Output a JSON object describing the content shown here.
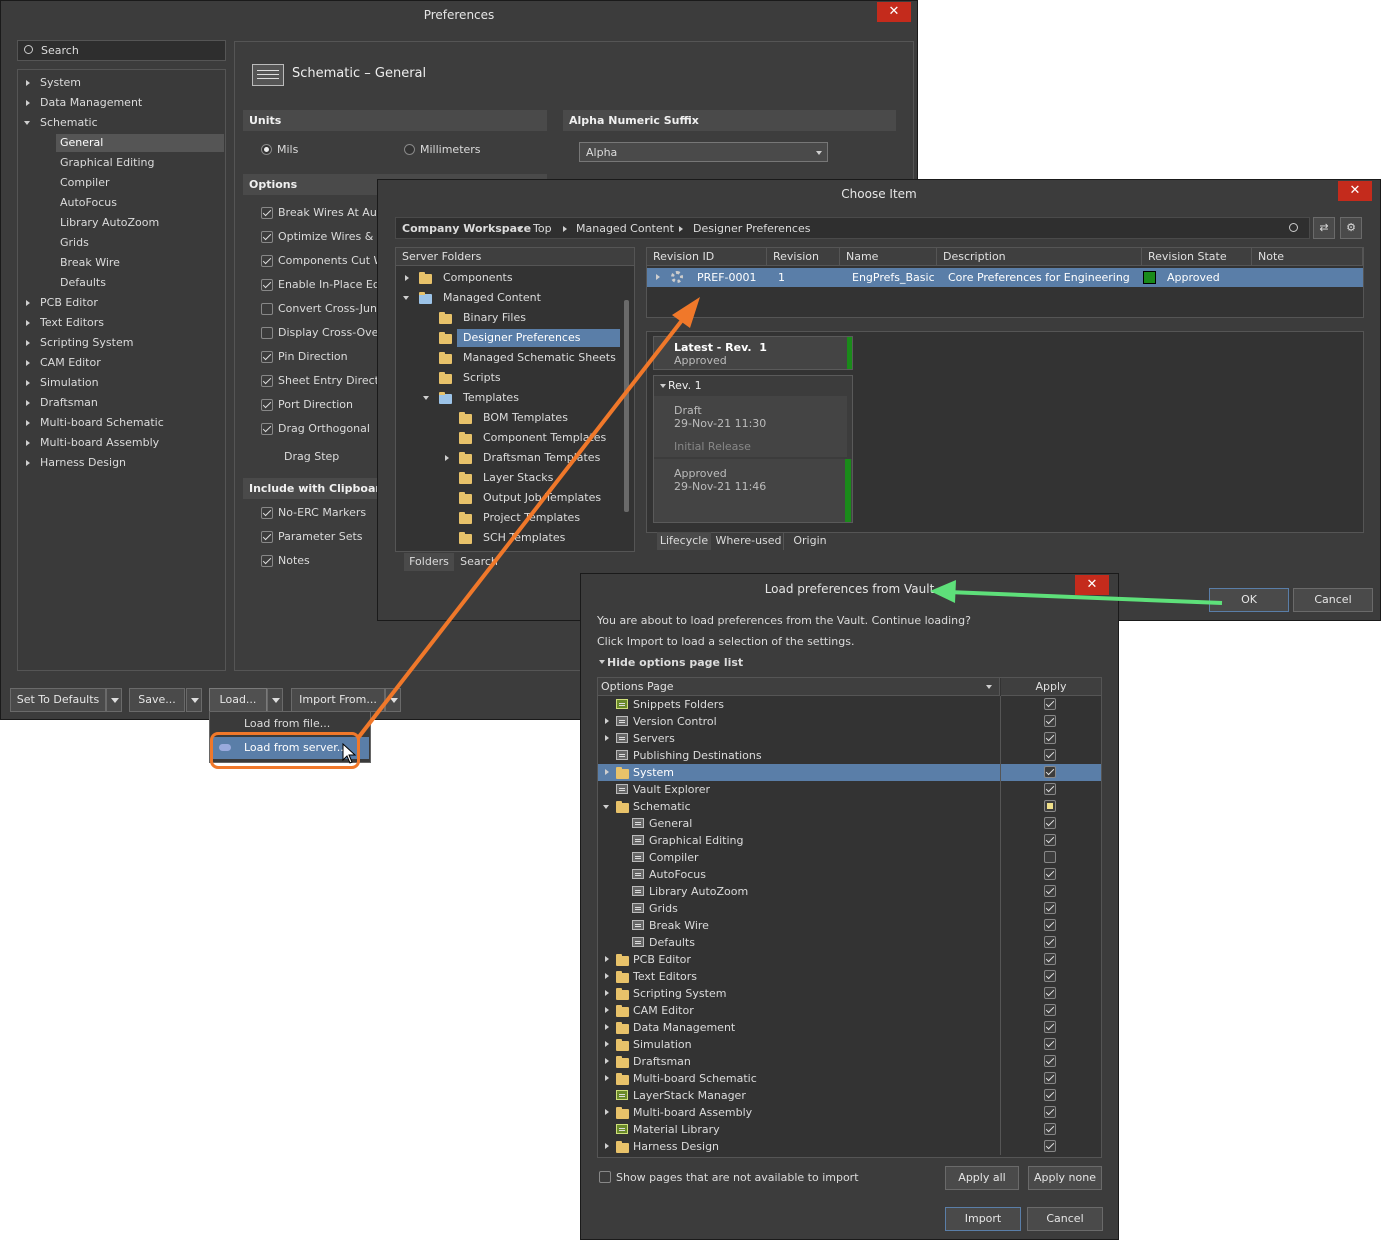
{
  "prefs": {
    "title": "Preferences",
    "close": "✕",
    "search_placeholder": "Search",
    "tree": [
      "System",
      "Data Management",
      "Schematic",
      "General",
      "Graphical Editing",
      "Compiler",
      "AutoFocus",
      "Library AutoZoom",
      "Grids",
      "Break Wire",
      "Defaults",
      "PCB Editor",
      "Text Editors",
      "Scripting System",
      "CAM Editor",
      "Simulation",
      "Draftsman",
      "Multi-board Schematic",
      "Multi-board Assembly",
      "Harness Design"
    ],
    "page_title": "Schematic – General",
    "units": {
      "heading": "Units",
      "mils": "Mils",
      "mm": "Millimeters"
    },
    "suffix": {
      "heading": "Alpha Numeric Suffix",
      "value": "Alpha"
    },
    "options": {
      "heading": "Options",
      "items": [
        "Break Wires At Auto",
        "Optimize Wires & B",
        "Components Cut W",
        "Enable In-Place Edit",
        "Convert Cross-Junc",
        "Display Cross-Overs",
        "Pin Direction",
        "Sheet Entry Directio",
        "Port Direction",
        "Drag Orthogonal"
      ],
      "drag_step": "Drag Step"
    },
    "clipboard": {
      "heading": "Include with Clipboard",
      "items": [
        "No-ERC Markers",
        "Parameter Sets",
        "Notes"
      ]
    },
    "buttons": {
      "defaults": "Set To Defaults",
      "save": "Save...",
      "load": "Load...",
      "import": "Import From..."
    },
    "load_menu": [
      "Load from file...",
      "Load from server..."
    ]
  },
  "choose": {
    "title": "Choose Item",
    "close": "✕",
    "breadcrumb": {
      "workspace": "Company Workspace",
      "path": [
        "Top",
        "Managed Content",
        "Designer Preferences"
      ]
    },
    "folders_header": "Server Folders",
    "folders": [
      "Components",
      "Managed Content",
      "Binary Files",
      "Designer Preferences",
      "Managed Schematic Sheets",
      "Scripts",
      "Templates",
      "BOM Templates",
      "Component Templates",
      "Draftsman Templates",
      "Layer Stacks",
      "Output Job Templates",
      "Project Templates",
      "SCH Templates"
    ],
    "tabs": [
      "Folders",
      "Search"
    ],
    "columns": [
      "Revision ID",
      "Revision",
      "Name",
      "Description",
      "Revision State",
      "Note"
    ],
    "row": {
      "id": "PREF-0001",
      "rev": "1",
      "name": "EngPrefs_Basic",
      "desc": "Core Preferences for Engineering",
      "state": "Approved"
    },
    "lifecycle": {
      "latest": "Latest - Rev.",
      "latest_num": "1",
      "latest_state": "Approved",
      "rev": "Rev. 1",
      "draft": "Draft",
      "draft_date": "29-Nov-21 11:30",
      "initial": "Initial Release",
      "approved": "Approved",
      "approved_date": "29-Nov-21 11:46"
    },
    "bottom_tabs": [
      "Lifecycle",
      "Where-used",
      "Origin"
    ],
    "ok": "OK",
    "cancel": "Cancel"
  },
  "vault": {
    "title": "Load preferences from Vault",
    "close": "✕",
    "msg1": "You are about to load preferences from the Vault. Continue loading?",
    "msg2": "Click Import to load a selection of the settings.",
    "toggle": "Hide options page list",
    "col_page": "Options Page",
    "col_apply": "Apply",
    "rows": [
      {
        "label": "Snippets Folders",
        "apply": "on"
      },
      {
        "label": "Version Control",
        "apply": "on"
      },
      {
        "label": "Servers",
        "apply": "on"
      },
      {
        "label": "Publishing Destinations",
        "apply": "on"
      },
      {
        "label": "System",
        "apply": "on"
      },
      {
        "label": "Vault Explorer",
        "apply": "on"
      },
      {
        "label": "Schematic",
        "apply": "partial"
      },
      {
        "label": "General",
        "apply": "on"
      },
      {
        "label": "Graphical Editing",
        "apply": "on"
      },
      {
        "label": "Compiler",
        "apply": "off"
      },
      {
        "label": "AutoFocus",
        "apply": "on"
      },
      {
        "label": "Library AutoZoom",
        "apply": "on"
      },
      {
        "label": "Grids",
        "apply": "on"
      },
      {
        "label": "Break Wire",
        "apply": "on"
      },
      {
        "label": "Defaults",
        "apply": "on"
      },
      {
        "label": "PCB Editor",
        "apply": "on"
      },
      {
        "label": "Text Editors",
        "apply": "on"
      },
      {
        "label": "Scripting System",
        "apply": "on"
      },
      {
        "label": "CAM Editor",
        "apply": "on"
      },
      {
        "label": "Data Management",
        "apply": "on"
      },
      {
        "label": "Simulation",
        "apply": "on"
      },
      {
        "label": "Draftsman",
        "apply": "on"
      },
      {
        "label": "Multi-board Schematic",
        "apply": "on"
      },
      {
        "label": "LayerStack Manager",
        "apply": "on"
      },
      {
        "label": "Multi-board Assembly",
        "apply": "on"
      },
      {
        "label": "Material Library",
        "apply": "on"
      },
      {
        "label": "Harness Design",
        "apply": "on"
      }
    ],
    "show_unavailable": "Show pages that are not available to import",
    "apply_all": "Apply all",
    "apply_none": "Apply none",
    "import": "Import",
    "cancel": "Cancel"
  },
  "colors": {
    "accent": "#5a7ea8",
    "annotation_orange": "#f0782a",
    "annotation_green": "#5ee07a",
    "close_red": "#c42b1c",
    "approved_green": "#1a8a1a"
  }
}
